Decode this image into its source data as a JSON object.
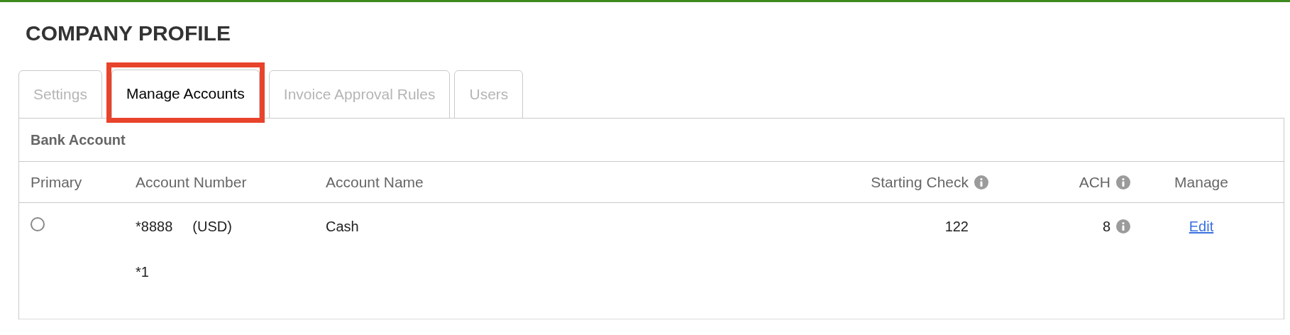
{
  "page": {
    "title": "COMPANY PROFILE"
  },
  "tabs": [
    {
      "label": "Settings",
      "selected": false,
      "highlighted": false
    },
    {
      "label": "Manage Accounts",
      "selected": true,
      "highlighted": true
    },
    {
      "label": "Invoice Approval Rules",
      "selected": false,
      "highlighted": false
    },
    {
      "label": "Users",
      "selected": false,
      "highlighted": false
    }
  ],
  "section": {
    "title": "Bank Account"
  },
  "table": {
    "columns": [
      {
        "label": "Primary",
        "kind": "plain"
      },
      {
        "label": "Account Number",
        "kind": "plain"
      },
      {
        "label": "Account Name",
        "kind": "plain"
      },
      {
        "label": "Starting Check",
        "kind": "info"
      },
      {
        "label": "ACH",
        "kind": "info"
      },
      {
        "label": "Manage",
        "kind": "plain"
      }
    ],
    "rows": [
      {
        "primary": false,
        "account_number": "*8888",
        "currency": "(USD)",
        "account_number_2": "*1",
        "account_name": "Cash",
        "starting_check": "122",
        "ach": "8",
        "manage": "Edit"
      }
    ]
  }
}
